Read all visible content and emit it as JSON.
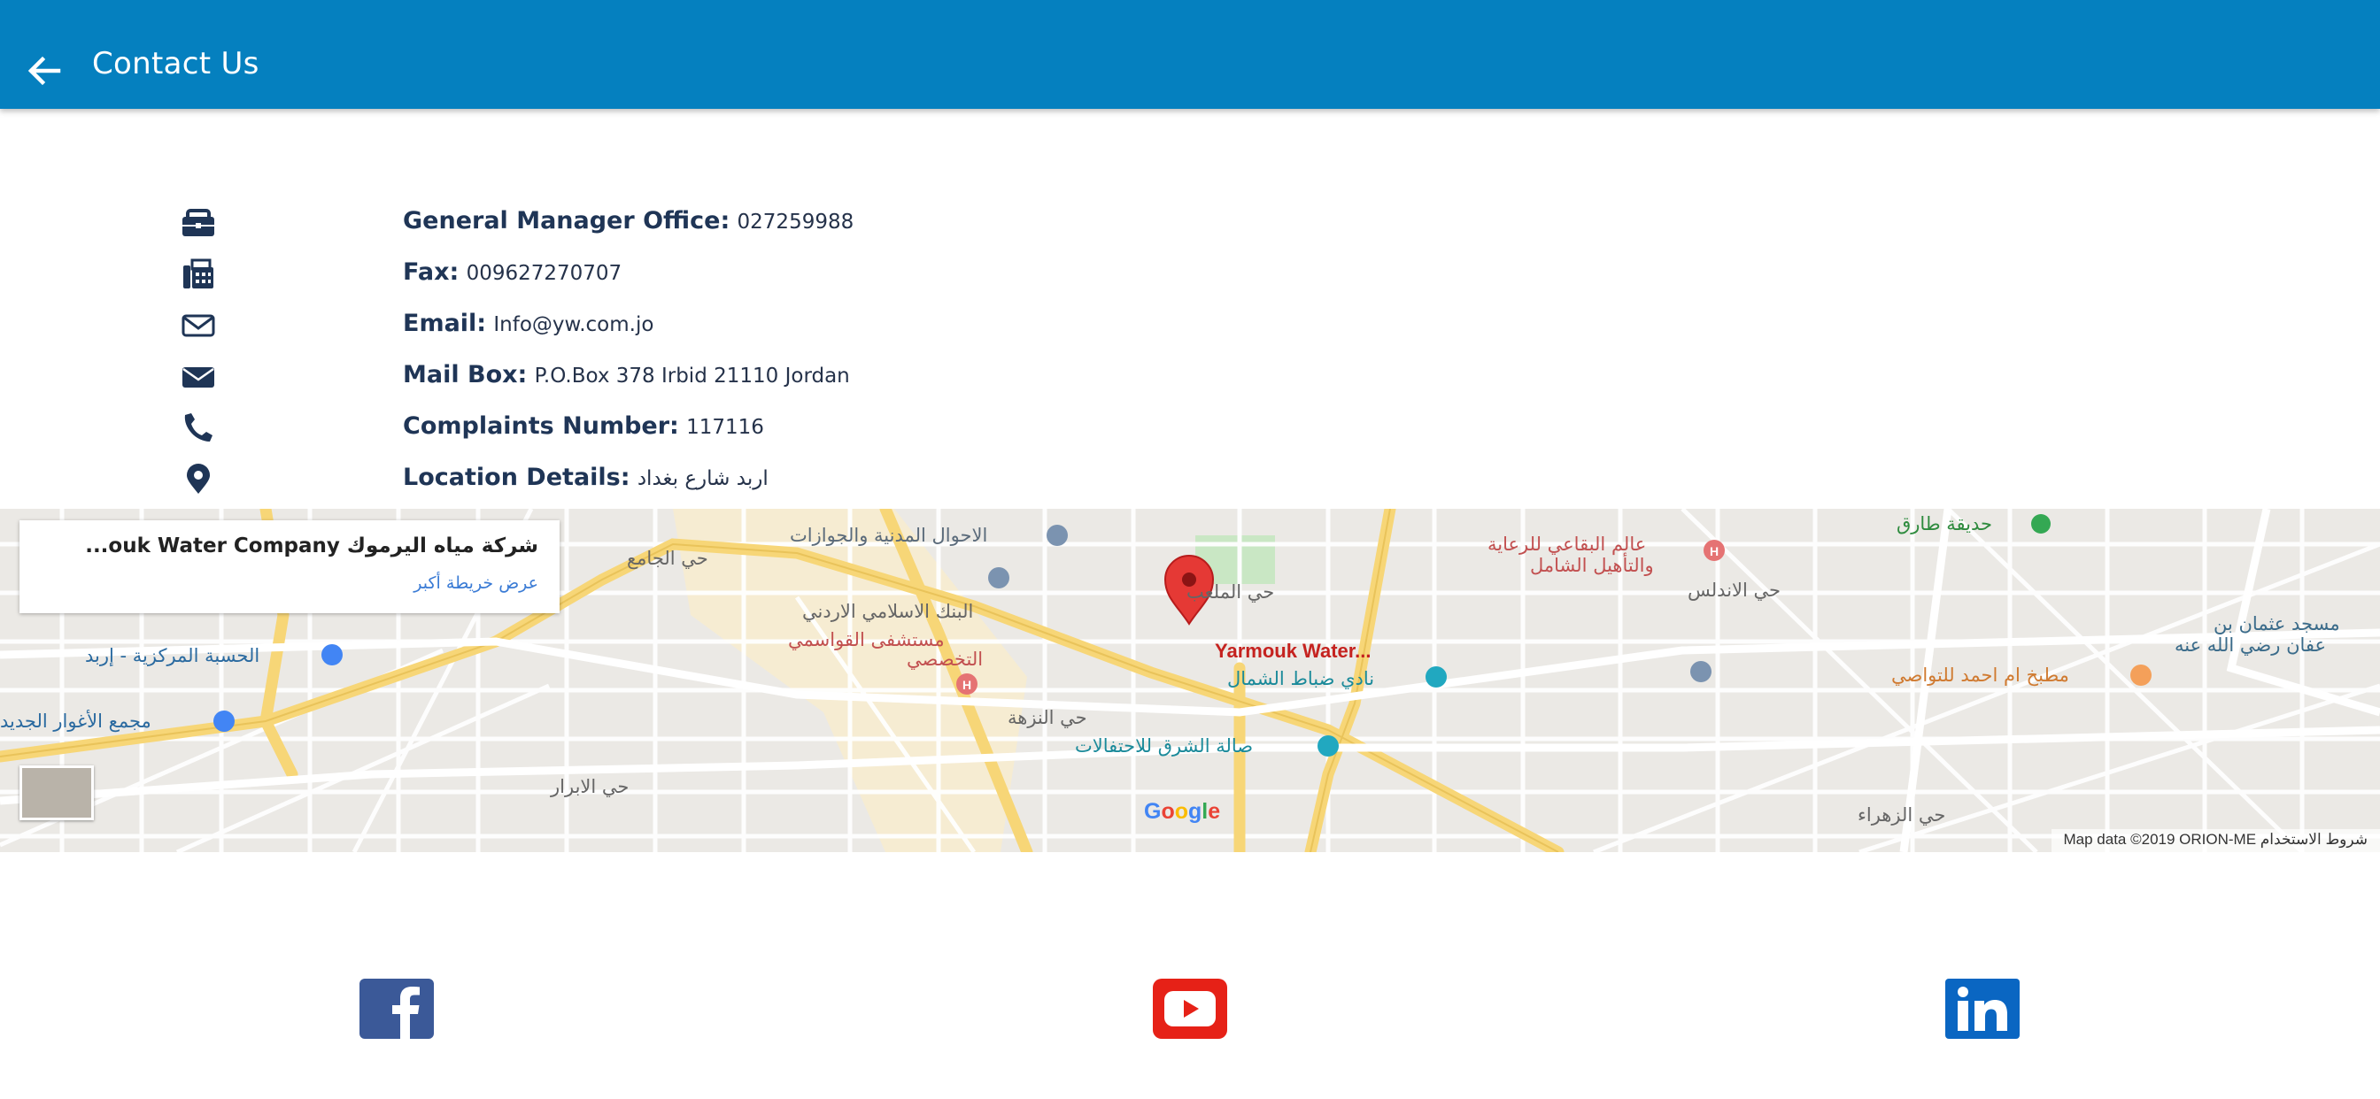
{
  "header": {
    "title": "Contact Us",
    "back_icon": "arrow-left-icon",
    "color": "#0580bf"
  },
  "contacts": [
    {
      "icon": "briefcase-icon",
      "label": "General Manager Office:",
      "value": "027259988"
    },
    {
      "icon": "fax-icon",
      "label": "Fax:",
      "value": "009627270707"
    },
    {
      "icon": "envelope-outline-icon",
      "label": "Email:",
      "value": "Info@yw.com.jo"
    },
    {
      "icon": "envelope-solid-icon",
      "label": "Mail Box:",
      "value": "P.O.Box 378 Irbid 21110 Jordan"
    },
    {
      "icon": "phone-icon",
      "label": "Complaints Number:",
      "value": "117116"
    },
    {
      "icon": "map-pin-icon",
      "label": "Location Details:",
      "value": "اربد شارع بغداد"
    }
  ],
  "map": {
    "card_name": "شركة مياه اليرموك ouk Water Company...",
    "card_link": "عرض خريطة أكبر",
    "marker_label": "Yarmouk Water...",
    "google": "Google",
    "attribution": "Map data ©2019 ORION-ME   شروط الاستخدام",
    "places": [
      {
        "text": "حديقة طارق",
        "color": "#2e8b3e"
      },
      {
        "text": "عالم البقاعي للرعاية",
        "color": "#c25050"
      },
      {
        "text": "والتأهيل الشامل",
        "color": "#c25050"
      },
      {
        "text": "الاحوال المدنية والجوازات",
        "color": "#5a6a7a"
      },
      {
        "text": "حي الجامع",
        "color": "#666"
      },
      {
        "text": "حي الملعب",
        "color": "#666"
      },
      {
        "text": "حي الاندلس",
        "color": "#666"
      },
      {
        "text": "مسجد عثمان بن",
        "color": "#3a6b8a"
      },
      {
        "text": "عفان رضي الله عنه",
        "color": "#3a6b8a"
      },
      {
        "text": "البنك الاسلامي الاردني",
        "color": "#666"
      },
      {
        "text": "مستشفى القواسمي",
        "color": "#c25050"
      },
      {
        "text": "التخصصي",
        "color": "#c25050"
      },
      {
        "text": "الحسبة المركزية - إربد",
        "color": "#2a6aa0"
      },
      {
        "text": "نادي ضباط الشمال",
        "color": "#1a8a9a"
      },
      {
        "text": "مطبخ ام احمد للتواصي",
        "color": "#d07a30"
      },
      {
        "text": "مجمع الأغوار الجديد",
        "color": "#2a6aa0"
      },
      {
        "text": "حي النزهة",
        "color": "#666"
      },
      {
        "text": "صالة الشرق للاحتفالات",
        "color": "#1a8a9a"
      },
      {
        "text": "حي الابرار",
        "color": "#666"
      },
      {
        "text": "حي الزهراء",
        "color": "#666"
      }
    ]
  },
  "social": [
    {
      "name": "facebook",
      "icon": "facebook-icon",
      "color": "#3b5998"
    },
    {
      "name": "youtube",
      "icon": "youtube-icon",
      "color": "#e62117"
    },
    {
      "name": "linkedin",
      "icon": "linkedin-icon",
      "color": "#0a66c2"
    }
  ]
}
